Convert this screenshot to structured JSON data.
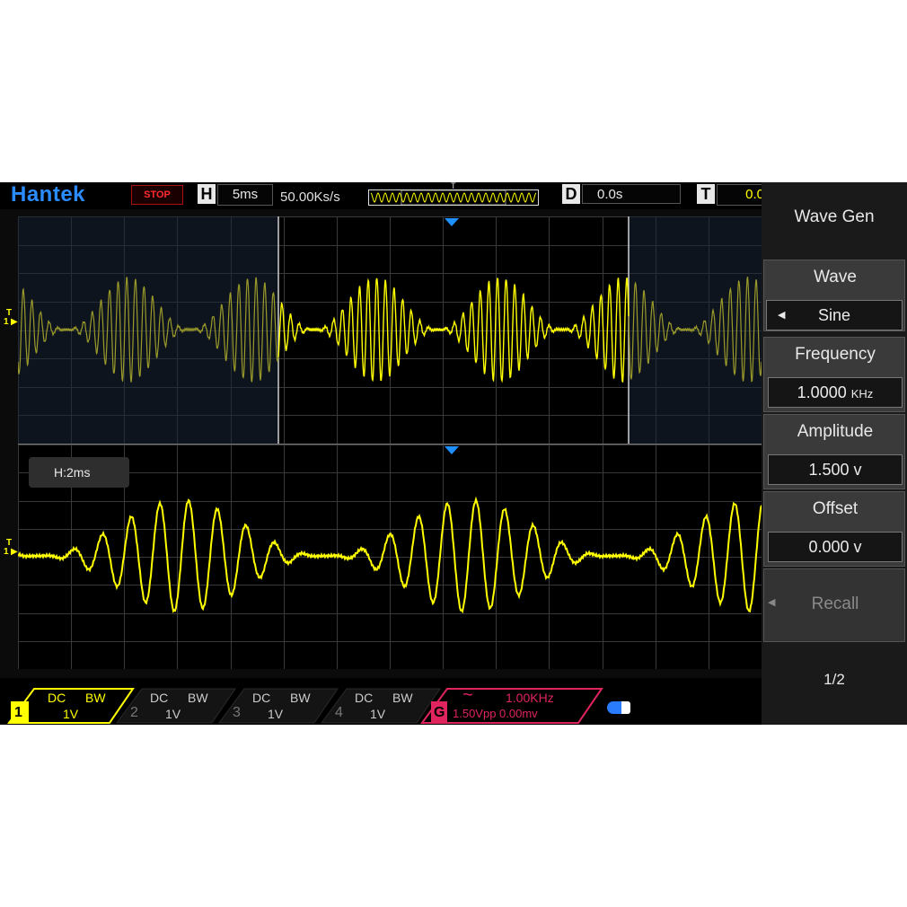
{
  "topbar": {
    "brand": "Hantek",
    "run_state": "STOP",
    "horizontal_tag": "H",
    "timebase": "5ms",
    "sample_rate": "50.00Ks/s",
    "trigger_marker": "T",
    "delay_tag": "D",
    "delay": "0.0s",
    "trigger_tag": "T",
    "trigger_level": "0.0"
  },
  "zoom_window": {
    "label": "H:2ms"
  },
  "channel_marker": {
    "trigger": "T",
    "channel": "1"
  },
  "menu": {
    "title": "Wave Gen",
    "wave_label": "Wave",
    "wave_value": "Sine",
    "frequency_label": "Frequency",
    "frequency_value": "1.0000",
    "frequency_unit": "KHz",
    "amplitude_label": "Amplitude",
    "amplitude_value": "1.500 v",
    "offset_label": "Offset",
    "offset_value": "0.000 v",
    "recall_label": "Recall",
    "page": "1/2"
  },
  "channels": [
    {
      "number": "1",
      "coupling": "DC",
      "bw": "BW",
      "scale": "1V",
      "color": "#ffff00",
      "active": true
    },
    {
      "number": "2",
      "coupling": "DC",
      "bw": "BW",
      "scale": "1V",
      "color": "#cccccc",
      "active": false
    },
    {
      "number": "3",
      "coupling": "DC",
      "bw": "BW",
      "scale": "1V",
      "color": "#cccccc",
      "active": false
    },
    {
      "number": "4",
      "coupling": "DC",
      "bw": "BW",
      "scale": "1V",
      "color": "#cccccc",
      "active": false
    }
  ],
  "generator": {
    "tag": "G",
    "wave_symbol": "~",
    "frequency": "1.00KHz",
    "amplitude_offset": "1.50Vpp 0.00mv",
    "color": "#e0245e"
  },
  "colors": {
    "trace": "#ffff00",
    "brand": "#2a8cff",
    "stop": "#ff2a2a",
    "marker": "#1e90ff"
  }
}
